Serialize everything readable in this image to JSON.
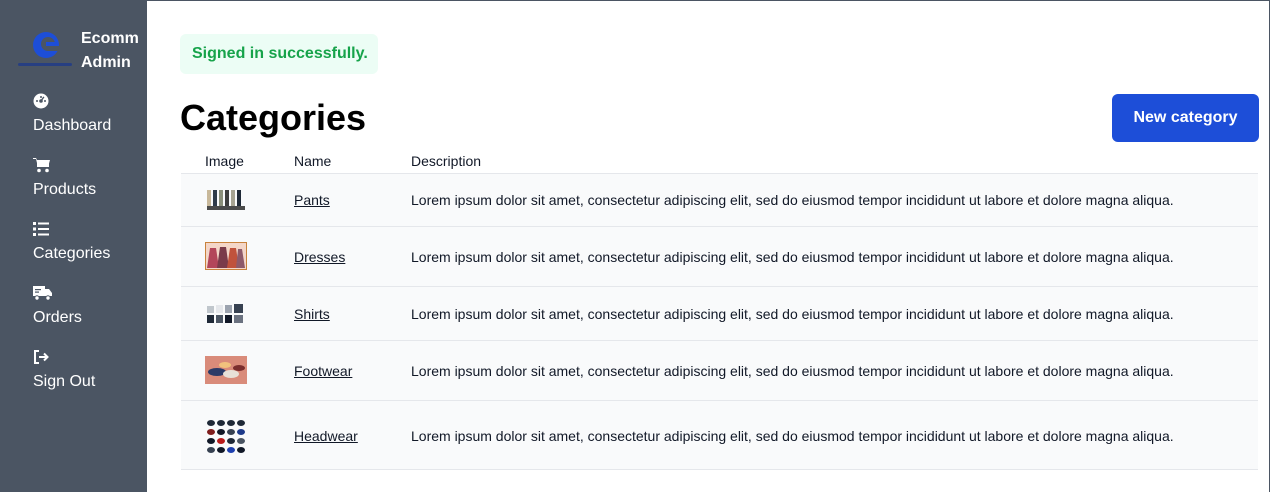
{
  "brand": {
    "name": "Ecomm Admin"
  },
  "nav": [
    {
      "label": "Dashboard",
      "icon": "dashboard-icon"
    },
    {
      "label": "Products",
      "icon": "cart-icon"
    },
    {
      "label": "Categories",
      "icon": "list-icon"
    },
    {
      "label": "Orders",
      "icon": "truck-icon"
    },
    {
      "label": "Sign Out",
      "icon": "sign-out-icon"
    }
  ],
  "flash": "Signed in successfully.",
  "page": {
    "title": "Categories",
    "new_button": "New category"
  },
  "table": {
    "headers": [
      "Image",
      "Name",
      "Description"
    ],
    "rows": [
      {
        "name": "Pants",
        "description": "Lorem ipsum dolor sit amet, consectetur adipiscing elit, sed do eiusmod tempor incididunt ut labore et dolore magna aliqua."
      },
      {
        "name": "Dresses",
        "description": "Lorem ipsum dolor sit amet, consectetur adipiscing elit, sed do eiusmod tempor incididunt ut labore et dolore magna aliqua."
      },
      {
        "name": "Shirts",
        "description": "Lorem ipsum dolor sit amet, consectetur adipiscing elit, sed do eiusmod tempor incididunt ut labore et dolore magna aliqua."
      },
      {
        "name": "Footwear",
        "description": "Lorem ipsum dolor sit amet, consectetur adipiscing elit, sed do eiusmod tempor incididunt ut labore et dolore magna aliqua."
      },
      {
        "name": "Headwear",
        "description": "Lorem ipsum dolor sit amet, consectetur adipiscing elit, sed do eiusmod tempor incididunt ut labore et dolore magna aliqua."
      }
    ]
  },
  "colors": {
    "sidebar": "#4b5563",
    "accent": "#1d4ed8",
    "success": "#16a34a"
  }
}
